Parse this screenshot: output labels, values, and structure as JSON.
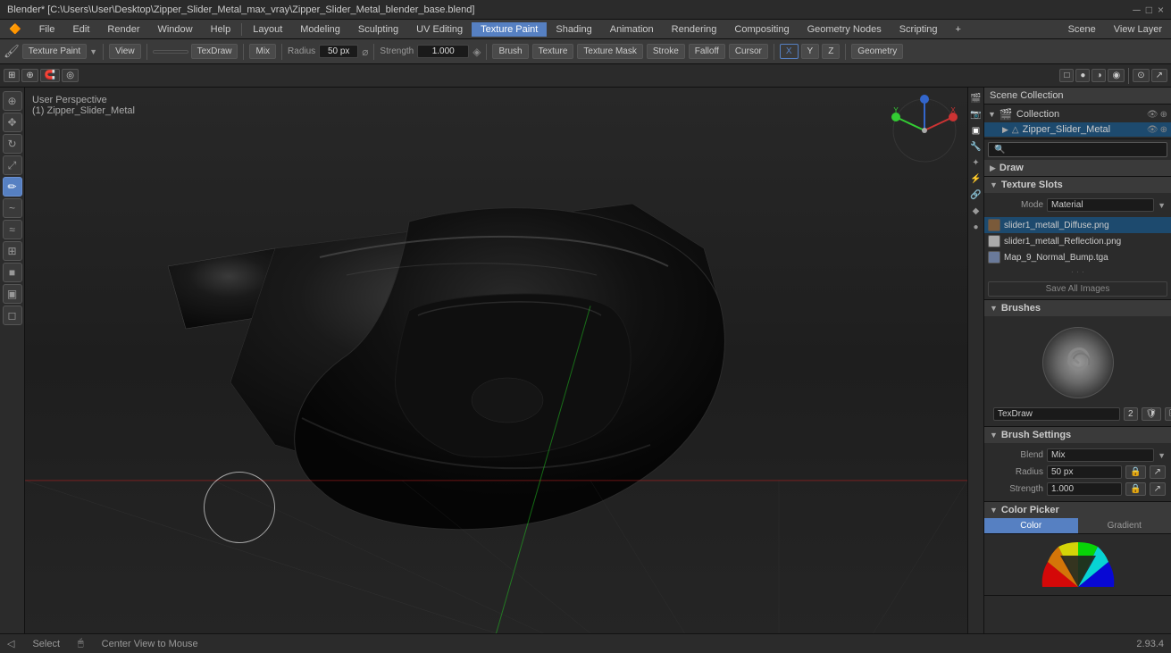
{
  "titlebar": {
    "title": "Blender* [C:\\Users\\User\\Desktop\\Zipper_Slider_Metal_max_vray\\Zipper_Slider_Metal_blender_base.blend]",
    "controls": [
      "─",
      "□",
      "×"
    ]
  },
  "menubar": {
    "items": [
      "Blender",
      "File",
      "Edit",
      "Render",
      "Window",
      "Help"
    ],
    "workspace_items": [
      "Layout",
      "Modeling",
      "Sculpting",
      "UV Editing",
      "Texture Paint",
      "Shading",
      "Animation",
      "Rendering",
      "Compositing",
      "Geometry Nodes",
      "Scripting",
      "+"
    ],
    "active_workspace": "Texture Paint",
    "right_items": [
      "Scene",
      "View Layer"
    ]
  },
  "toolbar": {
    "mode": "Texture Paint",
    "view_menu": "View",
    "tool_name": "TexDraw",
    "blend_mode": "Mix",
    "radius_label": "Radius",
    "radius_value": "50 px",
    "strength_label": "Strength",
    "strength_value": "1.000",
    "brush_label": "Brush",
    "texture_label": "Texture",
    "texture_mask_label": "Texture Mask",
    "stroke_label": "Stroke",
    "falloff_label": "Falloff",
    "cursor_label": "Cursor",
    "axes": [
      "X",
      "Y",
      "Z"
    ],
    "geometry_label": "Geometry"
  },
  "viewport": {
    "info_line1": "User Perspective",
    "info_line2": "(1) Zipper_Slider_Metal",
    "version": "2.93.4"
  },
  "left_tools": [
    {
      "name": "cursor",
      "icon": "⊕",
      "active": false
    },
    {
      "name": "move",
      "icon": "✥",
      "active": false
    },
    {
      "name": "rotate",
      "icon": "↻",
      "active": false
    },
    {
      "name": "scale",
      "icon": "⤢",
      "active": false
    },
    {
      "name": "draw",
      "icon": "✏",
      "active": true
    },
    {
      "name": "soften",
      "icon": "~",
      "active": false
    },
    {
      "name": "smear",
      "icon": "≈",
      "active": false
    },
    {
      "name": "clone",
      "icon": "⊞",
      "active": false
    },
    {
      "name": "fill",
      "icon": "◼",
      "active": false
    },
    {
      "name": "mask",
      "icon": "▣",
      "active": false
    },
    {
      "name": "eraser",
      "icon": "◻",
      "active": false
    }
  ],
  "scene_collection": {
    "title": "Scene Collection",
    "collections": [
      {
        "label": "Collection",
        "indent": 0,
        "expanded": true,
        "icon": "📁"
      },
      {
        "label": "Zipper_Slider_Metal",
        "indent": 1,
        "expanded": false,
        "icon": "▶",
        "active": true
      }
    ]
  },
  "panel": {
    "search_placeholder": "🔍",
    "draw_label": "Draw",
    "texture_slots_label": "Texture Slots",
    "mode_label": "Mode",
    "mode_value": "Material",
    "textures": [
      {
        "label": "slider1_metall_Diffuse.png",
        "color": "#7a5a3a",
        "active": true
      },
      {
        "label": "slider1_metall_Reflection.png",
        "color": "#aaaaaa",
        "active": false
      },
      {
        "label": "Map_9_Normal_Bump.tga",
        "color": "#6a7a9a",
        "active": false
      }
    ],
    "save_all_btn": "Save All Images",
    "brushes_label": "Brushes",
    "brush_name": "TexDraw",
    "brush_num": "2",
    "brush_settings_label": "Brush Settings",
    "blend_label": "Blend",
    "blend_value": "Mix",
    "radius_label": "Radius",
    "radius_value": "50 px",
    "strength_label": "Strength",
    "strength_value": "1.000",
    "color_picker_label": "Color Picker",
    "color_tab1": "Color",
    "color_tab2": "Gradient"
  },
  "statusbar": {
    "select": "Select",
    "center_view": "Center View to Mouse",
    "version": "2.93.4"
  }
}
